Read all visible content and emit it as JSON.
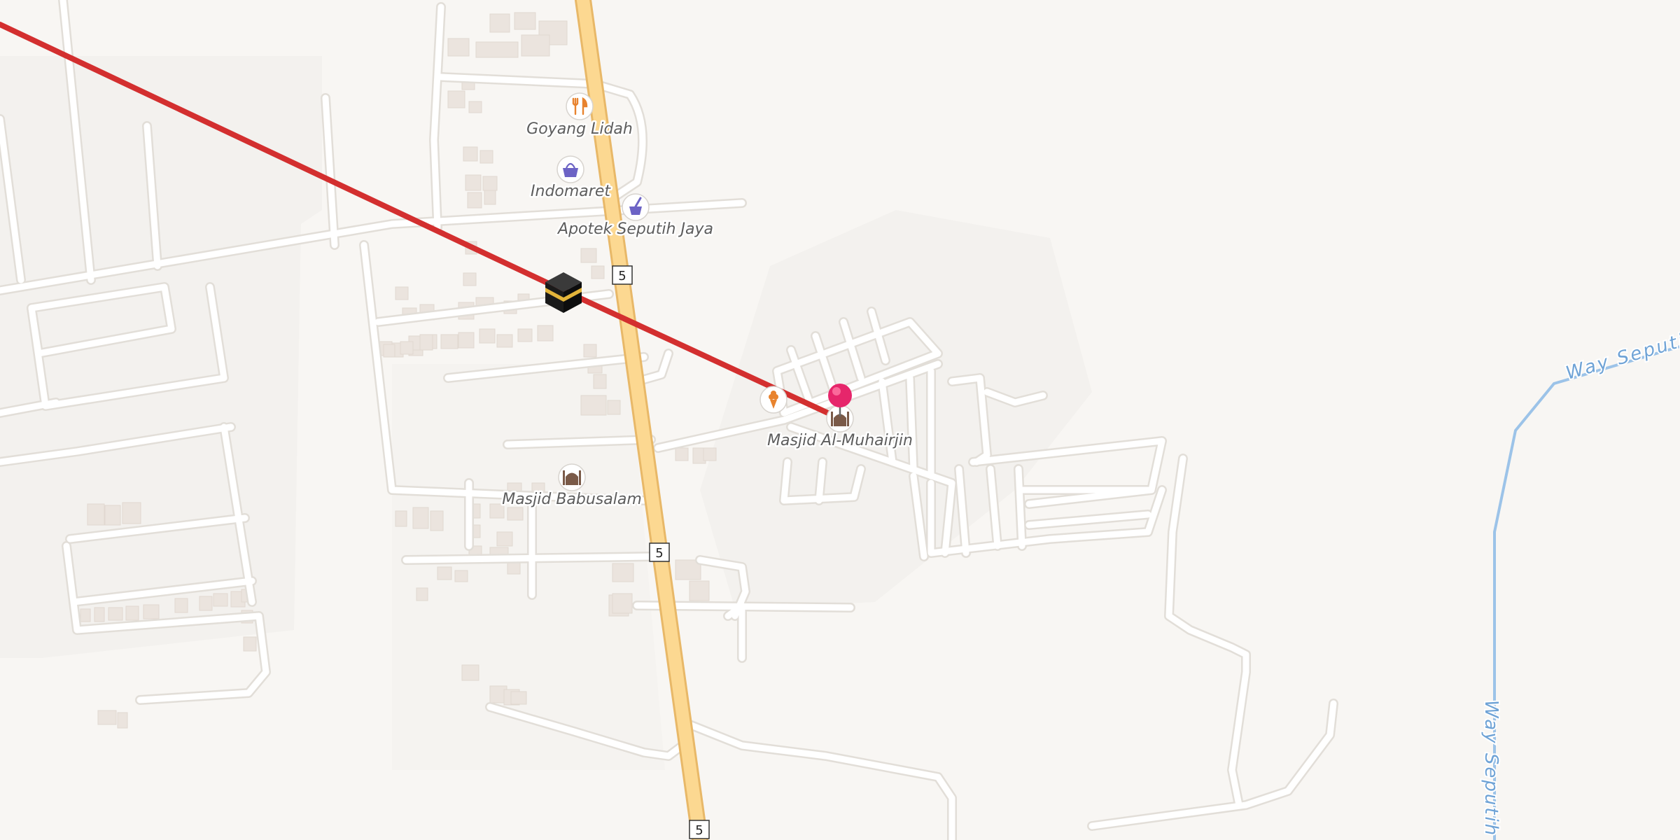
{
  "map": {
    "colors": {
      "background": "#f8f6f3",
      "road_minor": "#ffffff",
      "road_minor_casing": "#e4e0da",
      "road_primary": "#fcd891",
      "road_primary_casing": "#e8b868",
      "building": "#ece5df",
      "route_line": "#d32f2f",
      "river": "#9cc3e8",
      "pin": "#e6266b"
    },
    "road_shields": [
      "5",
      "5",
      "5"
    ],
    "pois": [
      {
        "name": "Goyang Lidah",
        "icon": "restaurant-icon"
      },
      {
        "name": "Indomaret",
        "icon": "shopping-basket-icon"
      },
      {
        "name": "Apotek Seputih Jaya",
        "icon": "pharmacy-icon"
      },
      {
        "name": "Masjid Al-Muhairjin",
        "icon": "mosque-icon"
      },
      {
        "name": "Masjid Babusalam",
        "icon": "mosque-icon"
      },
      {
        "name": "",
        "icon": "ice-cream-icon"
      }
    ],
    "rivers": [
      {
        "name": "Way Seputih"
      },
      {
        "name": "Way Seputih"
      }
    ],
    "markers": {
      "kaaba": "kaaba-icon",
      "location_pin": "location-pin-icon"
    }
  }
}
